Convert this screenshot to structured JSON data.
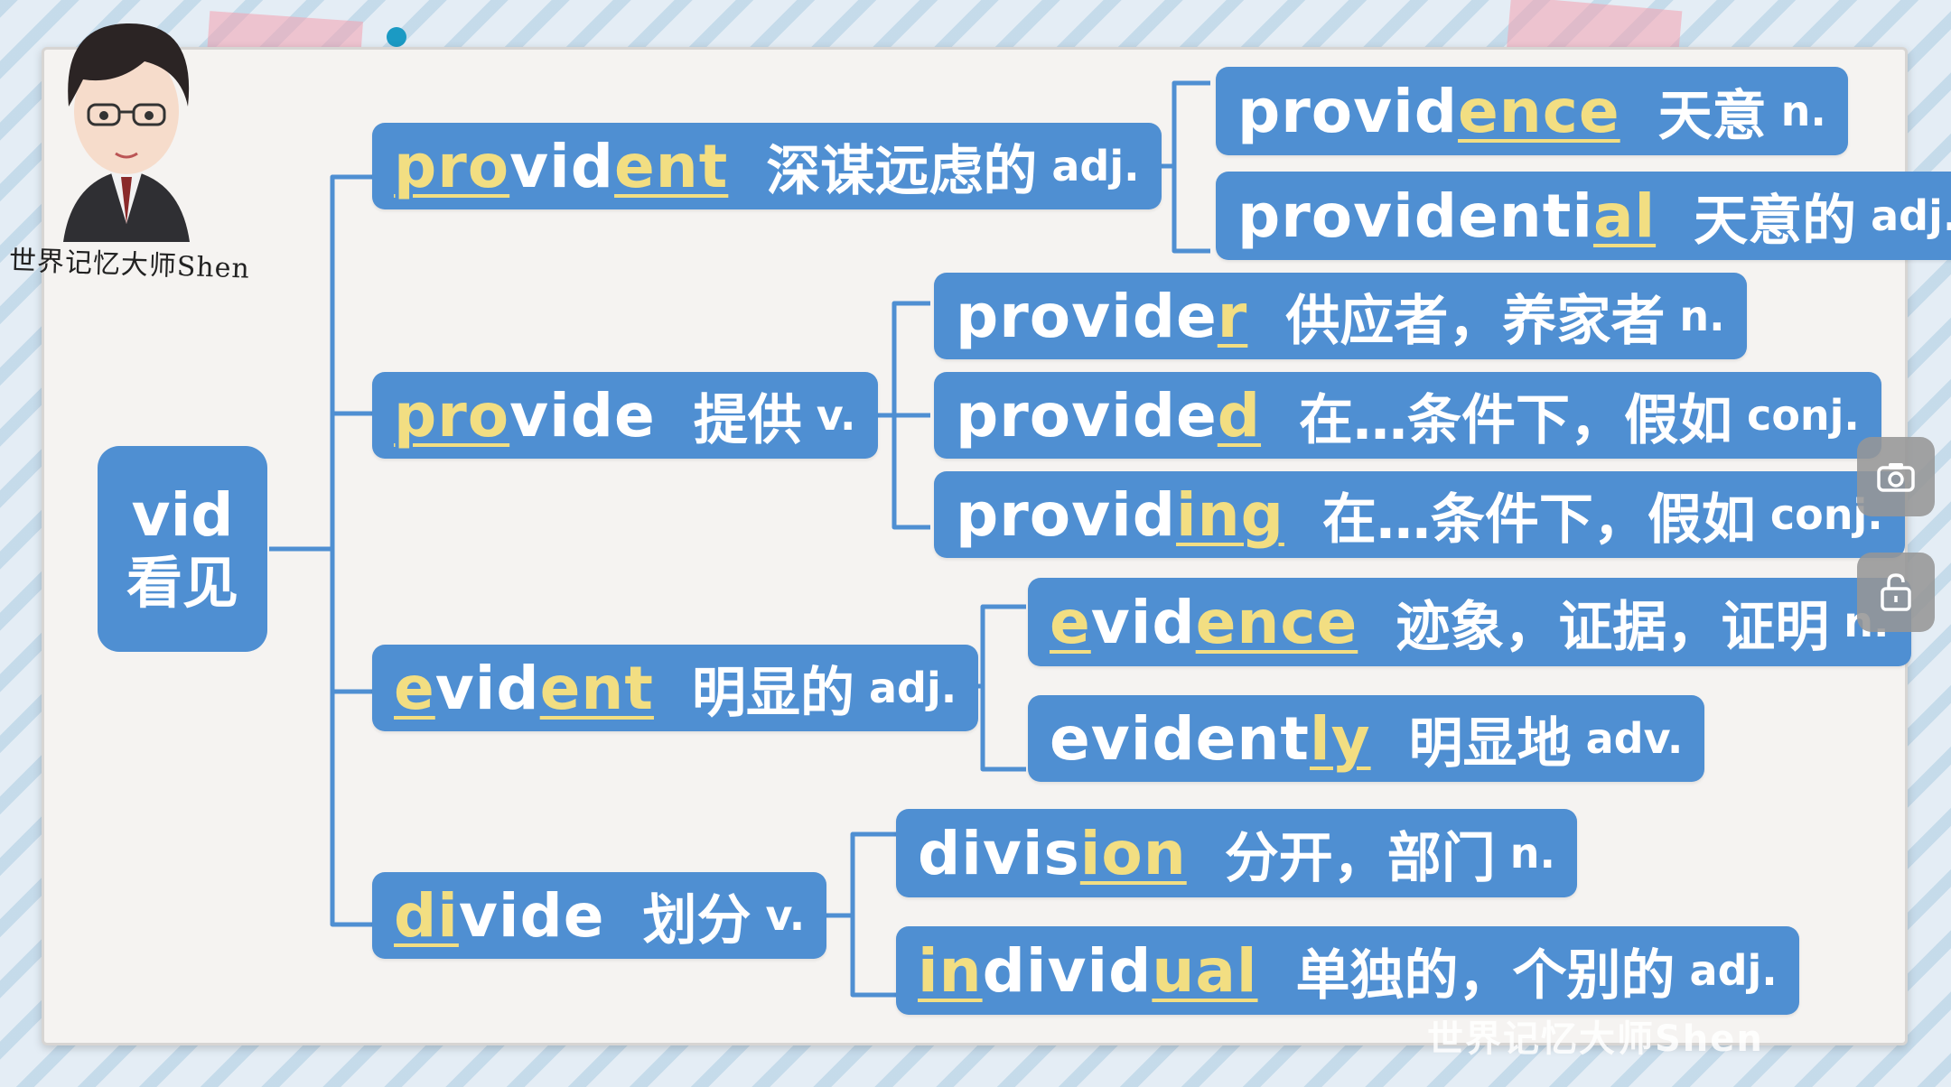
{
  "root": {
    "en": "vid",
    "cn": "看见"
  },
  "groups": [
    {
      "parent": {
        "parts": [
          [
            "pro",
            true
          ],
          [
            "vid",
            false
          ],
          [
            "ent",
            true
          ]
        ],
        "cn": "深谋远虑的",
        "pos": "adj."
      },
      "children": [
        {
          "parts": [
            [
              "provid",
              false
            ],
            [
              "ence",
              true
            ]
          ],
          "cn": "天意",
          "pos": "n."
        },
        {
          "parts": [
            [
              "providenti",
              false
            ],
            [
              "al",
              true
            ]
          ],
          "cn": "天意的",
          "pos": "adj."
        }
      ]
    },
    {
      "parent": {
        "parts": [
          [
            "pro",
            true
          ],
          [
            "vide",
            false
          ]
        ],
        "cn": "提供",
        "pos": "v."
      },
      "children": [
        {
          "parts": [
            [
              "provide",
              false
            ],
            [
              "r",
              true
            ]
          ],
          "cn": "供应者，养家者",
          "pos": "n."
        },
        {
          "parts": [
            [
              "provide",
              false
            ],
            [
              "d",
              true
            ]
          ],
          "cn": "在…条件下，假如",
          "pos": "conj."
        },
        {
          "parts": [
            [
              "provid",
              false
            ],
            [
              "ing",
              true
            ]
          ],
          "cn": "在…条件下，假如",
          "pos": "conj."
        }
      ]
    },
    {
      "parent": {
        "parts": [
          [
            "e",
            true
          ],
          [
            "vid",
            false
          ],
          [
            "ent",
            true
          ]
        ],
        "cn": "明显的",
        "pos": "adj."
      },
      "children": [
        {
          "parts": [
            [
              "e",
              true
            ],
            [
              "vid",
              false
            ],
            [
              "ence",
              true
            ]
          ],
          "cn": "迹象，证据，证明",
          "pos": "n."
        },
        {
          "parts": [
            [
              "evident",
              false
            ],
            [
              "ly",
              true
            ]
          ],
          "cn": "明显地",
          "pos": "adv."
        }
      ]
    },
    {
      "parent": {
        "parts": [
          [
            "di",
            true
          ],
          [
            "vide",
            false
          ]
        ],
        "cn": "划分",
        "pos": "v."
      },
      "children": [
        {
          "parts": [
            [
              "divis",
              false
            ],
            [
              "ion",
              true
            ]
          ],
          "cn": "分开，部门",
          "pos": "n."
        },
        {
          "parts": [
            [
              "in",
              true
            ],
            [
              "divid",
              false
            ],
            [
              "ual",
              true
            ]
          ],
          "cn": "单独的，个别的",
          "pos": "adj."
        }
      ]
    }
  ],
  "signature": "世界记忆大师Shen",
  "watermark": "世界记忆大师Shen",
  "icons": {
    "camera": "camera-icon",
    "lock": "unlock-icon"
  },
  "colors": {
    "box": "#4f8fd2",
    "highlight": "#f2de82",
    "line": "#4f8fd2"
  }
}
